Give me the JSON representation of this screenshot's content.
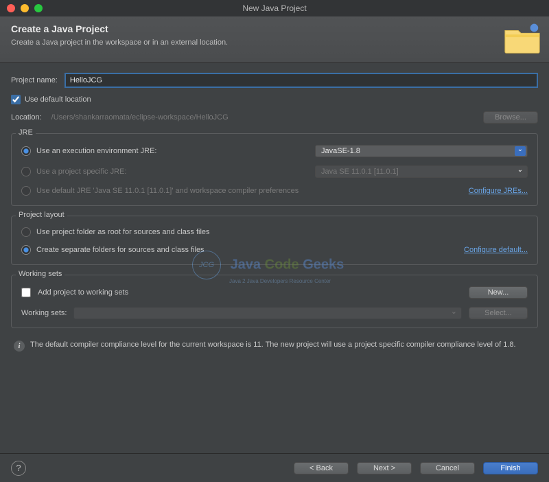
{
  "window": {
    "title": "New Java Project"
  },
  "banner": {
    "heading": "Create a Java Project",
    "sub": "Create a Java project in the workspace or in an external location."
  },
  "projectName": {
    "label": "Project name:",
    "value": "HelloJCG"
  },
  "defaultLocation": {
    "label": "Use default location",
    "checked": true
  },
  "location": {
    "label": "Location:",
    "value": "/Users/shankarraomata/eclipse-workspace/HelloJCG",
    "browse": "Browse..."
  },
  "jre": {
    "legend": "JRE",
    "opt1": {
      "label": "Use an execution environment JRE:",
      "selected": true,
      "value": "JavaSE-1.8"
    },
    "opt2": {
      "label": "Use a project specific JRE:",
      "selected": false,
      "value": "Java SE 11.0.1 [11.0.1]"
    },
    "opt3": {
      "label": "Use default JRE 'Java SE 11.0.1 [11.0.1]' and workspace compiler preferences",
      "selected": false
    },
    "configure": "Configure JREs..."
  },
  "layout": {
    "legend": "Project layout",
    "opt1": {
      "label": "Use project folder as root for sources and class files",
      "selected": false
    },
    "opt2": {
      "label": "Create separate folders for sources and class files",
      "selected": true
    },
    "configure": "Configure default..."
  },
  "workingSets": {
    "legend": "Working sets",
    "add": {
      "label": "Add project to working sets",
      "checked": false
    },
    "new": "New...",
    "label": "Working sets:",
    "select": "Select..."
  },
  "info": "The default compiler compliance level for the current workspace is 11. The new project will use a project specific compiler compliance level of 1.8.",
  "footer": {
    "back": "< Back",
    "next": "Next >",
    "cancel": "Cancel",
    "finish": "Finish"
  },
  "watermark": {
    "brand1": "Java",
    "brand2": "Code",
    "brand3": "Geeks",
    "tag": "Java 2 Java Developers Resource Center"
  }
}
